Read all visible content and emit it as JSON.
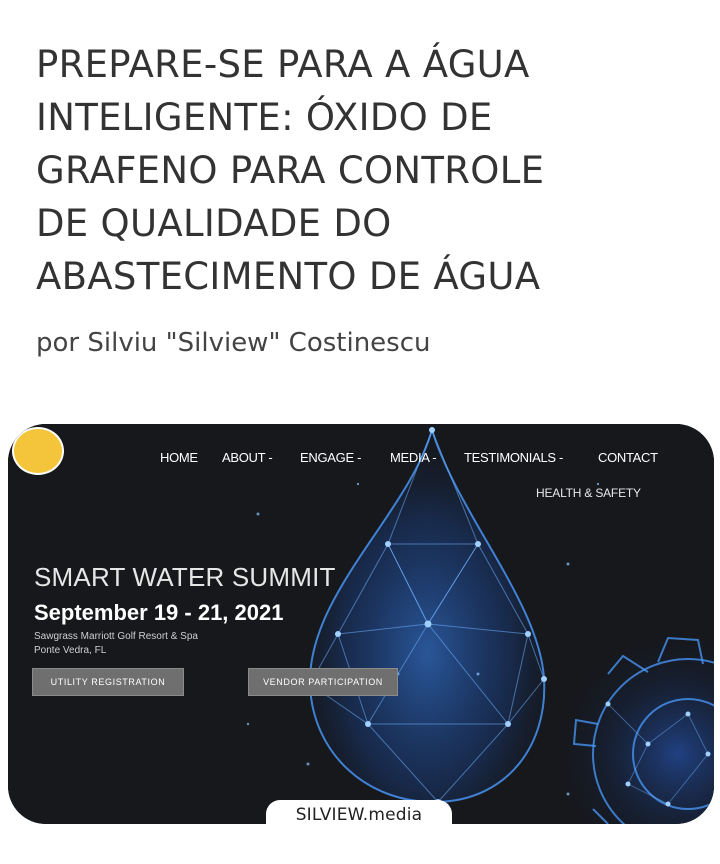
{
  "article": {
    "title_lines": [
      "PREPARE-SE PARA A ÁGUA",
      "INTELIGENTE: ÓXIDO DE",
      "GRAFENO PARA CONTROLE",
      "DE QUALIDADE DO",
      "ABASTECIMENTO DE ÁGUA"
    ],
    "byline": "por Silviu \"Silview\" Costinescu"
  },
  "site": {
    "nav": {
      "home": "HOME",
      "about": "ABOUT -",
      "engage": "ENGAGE -",
      "media": "MEDIA -",
      "testimonials": "TESTIMONIALS -",
      "contact": "CONTACT",
      "health_safety": "HEALTH & SAFETY"
    },
    "hero": {
      "title": "SMART WATER SUMMIT",
      "date": "September 19 - 21, 2021",
      "venue_line1": "Sawgrass Marriott Golf Resort & Spa",
      "venue_line2": "Ponte Vedra, FL"
    },
    "buttons": {
      "utility": "UTILITY REGISTRATION",
      "vendor": "VENDOR PARTICIPATION"
    }
  },
  "watermark": "SILVIEW.media",
  "colors": {
    "hero_background": "#16181c",
    "water_glow": "#2f7dff",
    "logo_badge": "#f4c53a",
    "button": "#6f6f6f"
  }
}
